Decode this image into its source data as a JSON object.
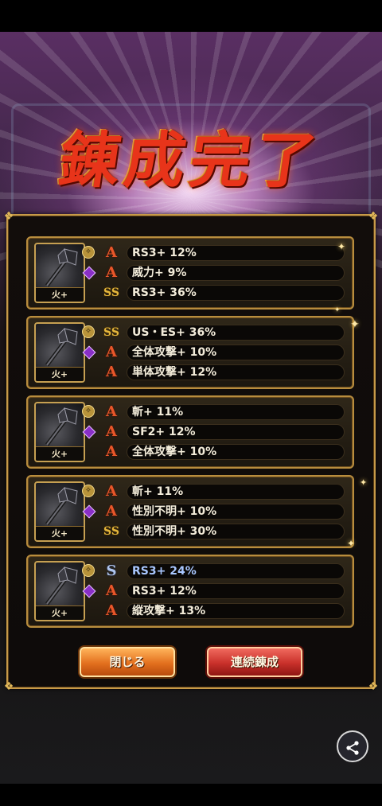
{
  "title": "錬成完了",
  "results": [
    {
      "weapon_label": "火+",
      "lines": [
        {
          "rank": "A",
          "text": "RS3+ 12%",
          "highlight": false
        },
        {
          "rank": "A",
          "text": "威力+ 9%",
          "highlight": false
        },
        {
          "rank": "SS",
          "text": "RS3+ 36%",
          "highlight": false
        }
      ]
    },
    {
      "weapon_label": "火+",
      "lines": [
        {
          "rank": "SS",
          "text": "US・ES+ 36%",
          "highlight": false
        },
        {
          "rank": "A",
          "text": "全体攻撃+ 10%",
          "highlight": false
        },
        {
          "rank": "A",
          "text": "単体攻撃+ 12%",
          "highlight": false
        }
      ]
    },
    {
      "weapon_label": "火+",
      "lines": [
        {
          "rank": "A",
          "text": "斬+ 11%",
          "highlight": false
        },
        {
          "rank": "A",
          "text": "SF2+ 12%",
          "highlight": false
        },
        {
          "rank": "A",
          "text": "全体攻撃+ 10%",
          "highlight": false
        }
      ]
    },
    {
      "weapon_label": "火+",
      "lines": [
        {
          "rank": "A",
          "text": "斬+ 11%",
          "highlight": false
        },
        {
          "rank": "A",
          "text": "性別不明+ 10%",
          "highlight": false
        },
        {
          "rank": "SS",
          "text": "性別不明+ 30%",
          "highlight": false
        }
      ]
    },
    {
      "weapon_label": "火+",
      "lines": [
        {
          "rank": "S",
          "text": "RS3+ 24%",
          "highlight": true
        },
        {
          "rank": "A",
          "text": "RS3+ 12%",
          "highlight": false
        },
        {
          "rank": "A",
          "text": "縦攻撃+ 13%",
          "highlight": false
        }
      ]
    }
  ],
  "buttons": {
    "close": "閉じる",
    "repeat": "連続錬成"
  },
  "icons": {
    "share": "share-icon",
    "weapon": "axe-weapon-icon",
    "weapon_badge": "rank-emblem-icon",
    "weapon_gem": "purple-gem-icon"
  },
  "colors": {
    "rank_A": "#e8572a",
    "rank_SS": "#e4b63c",
    "rank_S": "#b0c6ee",
    "frame_gold": "#c79a48"
  }
}
